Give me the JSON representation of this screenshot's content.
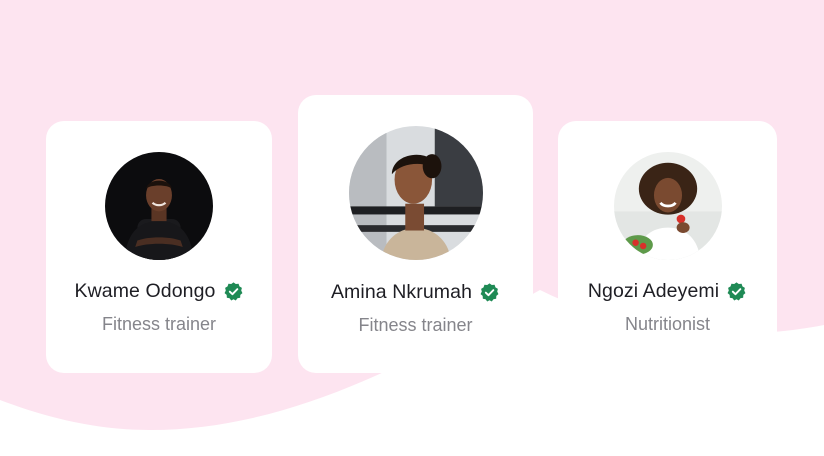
{
  "colors": {
    "background_pink": "#fde4f0",
    "card": "#ffffff",
    "verified_badge": "#1f8a55",
    "name_text": "#1e1e24",
    "role_text": "#85858b"
  },
  "profiles": [
    {
      "name": "Kwame Odongo",
      "role": "Fitness trainer",
      "verified": true,
      "badge_icon": "verified-badge-icon"
    },
    {
      "name": "Amina Nkrumah",
      "role": "Fitness trainer",
      "verified": true,
      "badge_icon": "verified-badge-icon"
    },
    {
      "name": "Ngozi Adeyemi",
      "role": "Nutritionist",
      "verified": true,
      "badge_icon": "verified-badge-icon"
    }
  ]
}
